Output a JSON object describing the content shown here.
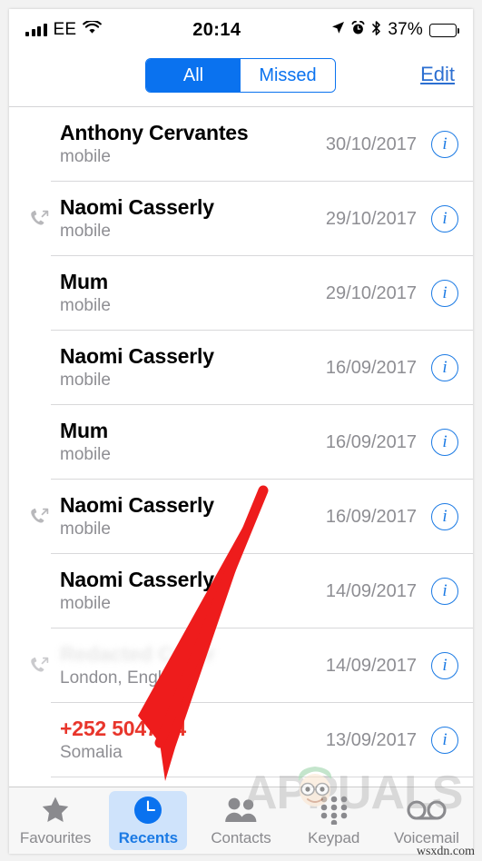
{
  "status_bar": {
    "carrier": "EE",
    "time": "20:14",
    "battery_percent": "37%",
    "battery_level": 37,
    "icons": [
      "signal-bars-icon",
      "wifi-icon",
      "location-arrow-icon",
      "alarm-clock-icon",
      "bluetooth-icon",
      "battery-icon"
    ]
  },
  "nav_bar": {
    "segments": [
      {
        "label": "All",
        "selected": true
      },
      {
        "label": "Missed",
        "selected": false
      }
    ],
    "edit_label": "Edit"
  },
  "call_list": {
    "rows": [
      {
        "name": "Anthony Cervantes",
        "subtitle": "mobile",
        "date": "30/10/2017",
        "direction": "none",
        "missed": false,
        "redacted": false
      },
      {
        "name": "Naomi Casserly",
        "subtitle": "mobile",
        "date": "29/10/2017",
        "direction": "outgoing",
        "missed": false,
        "redacted": false
      },
      {
        "name": "Mum",
        "subtitle": "mobile",
        "date": "29/10/2017",
        "direction": "none",
        "missed": false,
        "redacted": false
      },
      {
        "name": "Naomi Casserly",
        "subtitle": "mobile",
        "date": "16/09/2017",
        "direction": "none",
        "missed": false,
        "redacted": false
      },
      {
        "name": "Mum",
        "subtitle": "mobile",
        "date": "16/09/2017",
        "direction": "none",
        "missed": false,
        "redacted": false
      },
      {
        "name": "Naomi Casserly",
        "subtitle": "mobile",
        "date": "16/09/2017",
        "direction": "outgoing",
        "missed": false,
        "redacted": false
      },
      {
        "name": "Naomi Casserly",
        "subtitle": "mobile",
        "date": "14/09/2017",
        "direction": "none",
        "missed": false,
        "redacted": false
      },
      {
        "name": "Redacted Caller",
        "subtitle": "London, England",
        "date": "14/09/2017",
        "direction": "outgoing",
        "missed": false,
        "redacted": true
      },
      {
        "name": "+252 50470 4",
        "subtitle": "Somalia",
        "date": "13/09/2017",
        "direction": "none",
        "missed": true,
        "redacted": false
      }
    ],
    "info_glyph": "i"
  },
  "tab_bar": {
    "tabs": [
      {
        "label": "Favourites",
        "icon": "star-icon",
        "selected": false
      },
      {
        "label": "Recents",
        "icon": "clock-icon",
        "selected": true
      },
      {
        "label": "Contacts",
        "icon": "contacts-icon",
        "selected": false
      },
      {
        "label": "Keypad",
        "icon": "keypad-icon",
        "selected": false
      },
      {
        "label": "Voicemail",
        "icon": "voicemail-icon",
        "selected": false
      }
    ]
  },
  "overlays": {
    "arrow_color": "#ee1c1c",
    "watermark_text": "APPUALS",
    "watermark_url": "wsxdn.com"
  },
  "colors": {
    "accent_blue": "#0a72ef",
    "info_blue": "#1b7ae4",
    "missed_red": "#e8352b",
    "secondary_gray": "#8e8e93",
    "tab_inactive": "#8a8a8e",
    "tab_highlight": "#cfe3fb",
    "divider": "#d8d8da"
  }
}
